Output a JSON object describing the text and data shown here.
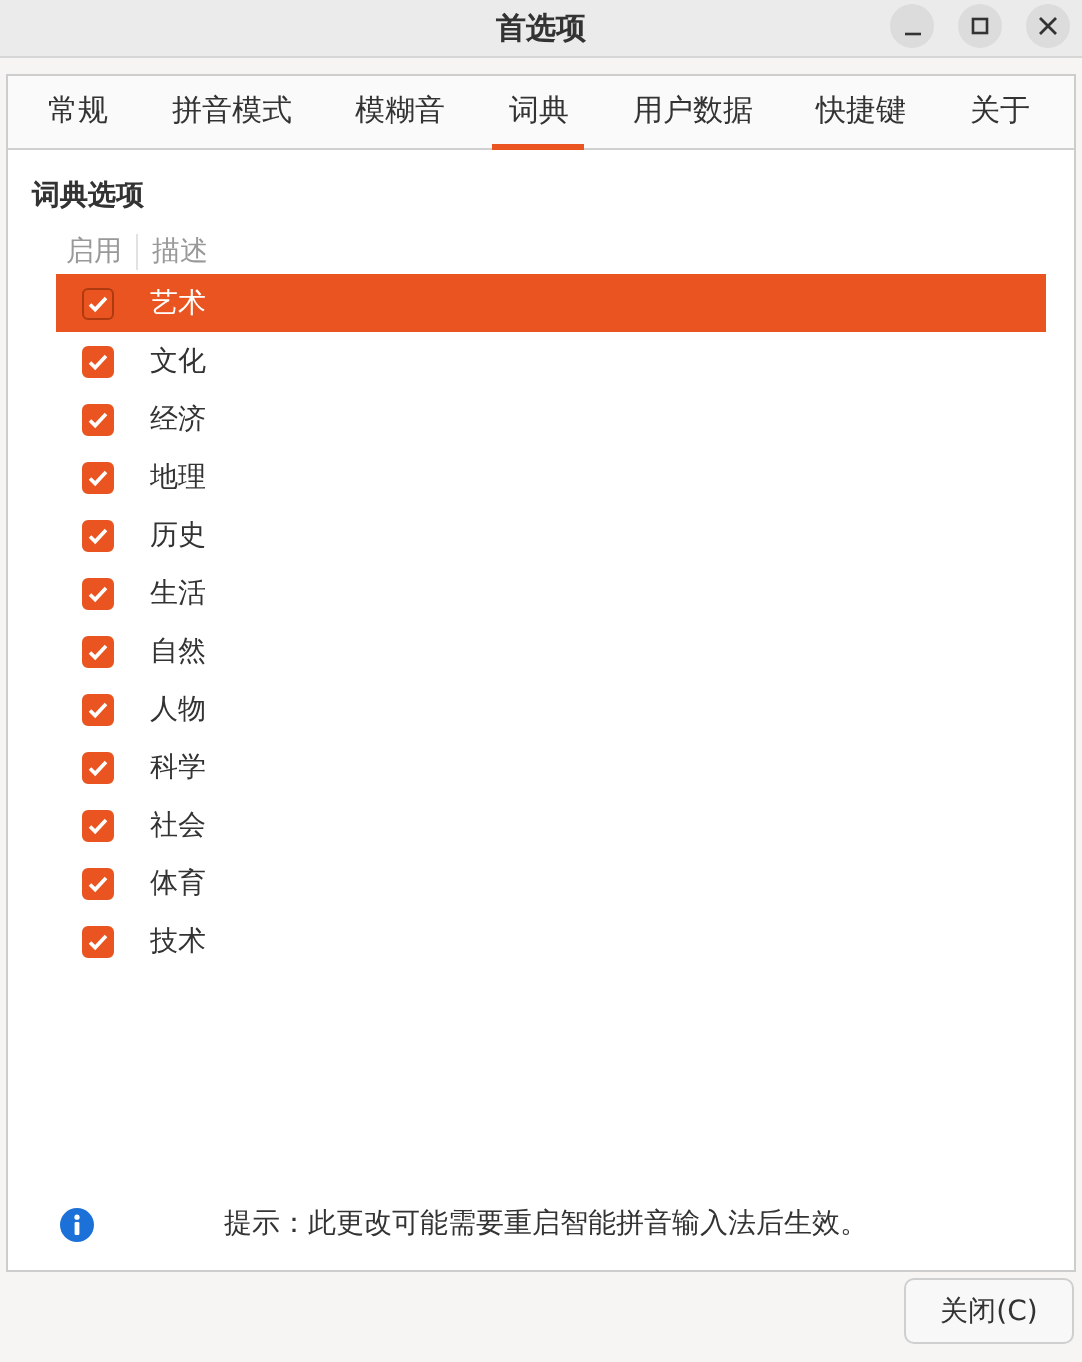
{
  "window": {
    "title": "首选项"
  },
  "tabs": [
    {
      "label": "常规",
      "selected": false
    },
    {
      "label": "拼音模式",
      "selected": false
    },
    {
      "label": "模糊音",
      "selected": false
    },
    {
      "label": "词典",
      "selected": true
    },
    {
      "label": "用户数据",
      "selected": false
    },
    {
      "label": "快捷键",
      "selected": false
    },
    {
      "label": "关于",
      "selected": false
    }
  ],
  "section_title": "词典选项",
  "table": {
    "columns": [
      "启用",
      "描述"
    ],
    "rows": [
      {
        "description": "艺术",
        "checked": true,
        "selected": true
      },
      {
        "description": "文化",
        "checked": true,
        "selected": false
      },
      {
        "description": "经济",
        "checked": true,
        "selected": false
      },
      {
        "description": "地理",
        "checked": true,
        "selected": false
      },
      {
        "description": "历史",
        "checked": true,
        "selected": false
      },
      {
        "description": "生活",
        "checked": true,
        "selected": false
      },
      {
        "description": "自然",
        "checked": true,
        "selected": false
      },
      {
        "description": "人物",
        "checked": true,
        "selected": false
      },
      {
        "description": "科学",
        "checked": true,
        "selected": false
      },
      {
        "description": "社会",
        "checked": true,
        "selected": false
      },
      {
        "description": "体育",
        "checked": true,
        "selected": false
      },
      {
        "description": "技术",
        "checked": true,
        "selected": false
      }
    ]
  },
  "hint": "提示：此更改可能需要重启智能拼音输入法后生效。",
  "buttons": [
    "关闭(C)"
  ]
}
